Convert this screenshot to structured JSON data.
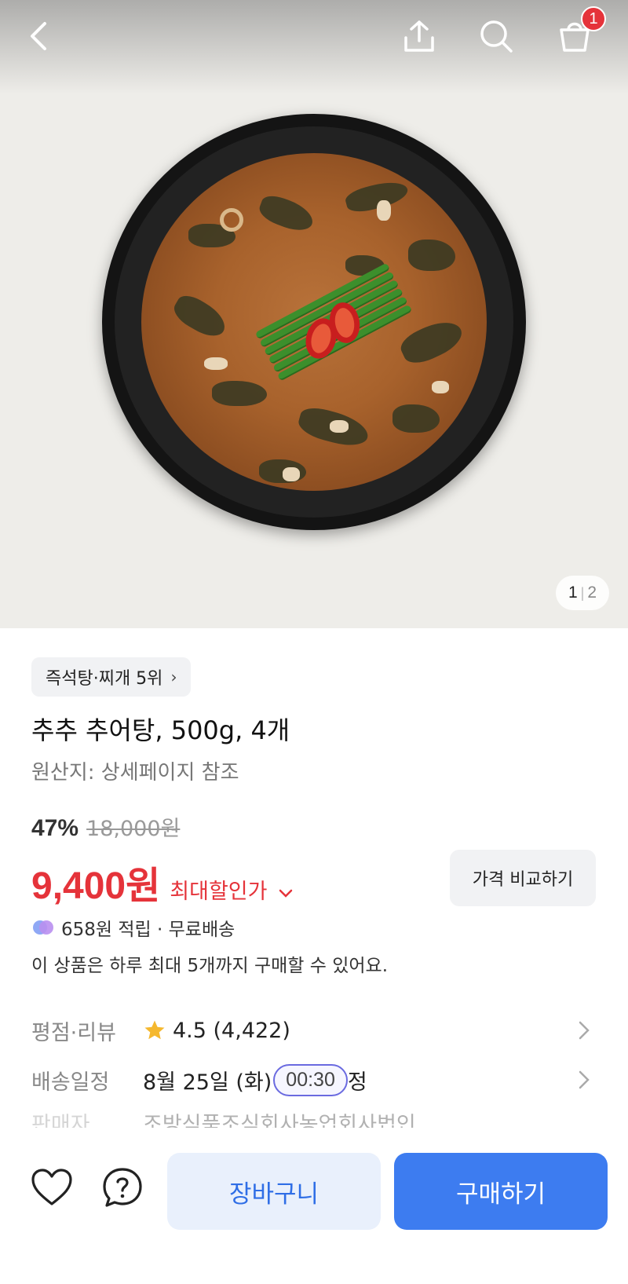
{
  "pager": {
    "current": "1",
    "total": "2"
  },
  "header": {
    "cart_count": "1"
  },
  "product": {
    "rank_chip": "즉석탕·찌개 5위",
    "title": "추추 추어탕, 500g, 4개",
    "origin": "원산지: 상세페이지 참조",
    "discount_rate": "47%",
    "original_price": "18,000원",
    "price": "9,400원",
    "max_discount_label": "최대할인가",
    "compare_label": "가격 비교하기",
    "benefit": "658원 적립 · 무료배송",
    "purchase_limit": "이 상품은 하루 최대 5개까지 구매할 수 있어요."
  },
  "info_rows": {
    "rating_label": "평점·리뷰",
    "rating_value": "4.5 (4,422)",
    "delivery_label": "배송일정",
    "delivery_date": "8월 25일 (화)",
    "delivery_time": "00:30",
    "delivery_suffix": "정",
    "seller_label": "판매자",
    "seller_value": "조방식품조식회사농업회사법인"
  },
  "actions": {
    "cart_label": "장바구니",
    "buy_label": "구매하기"
  },
  "colors": {
    "accent_red": "#e5333a",
    "accent_blue": "#3d7cf0",
    "star": "#f5b82e"
  },
  "icons": [
    "back-icon",
    "share-icon",
    "search-icon",
    "cart-icon",
    "heart-icon",
    "question-icon",
    "star-icon",
    "chevron-right-icon",
    "chevron-down-icon",
    "point-coin-icon"
  ]
}
